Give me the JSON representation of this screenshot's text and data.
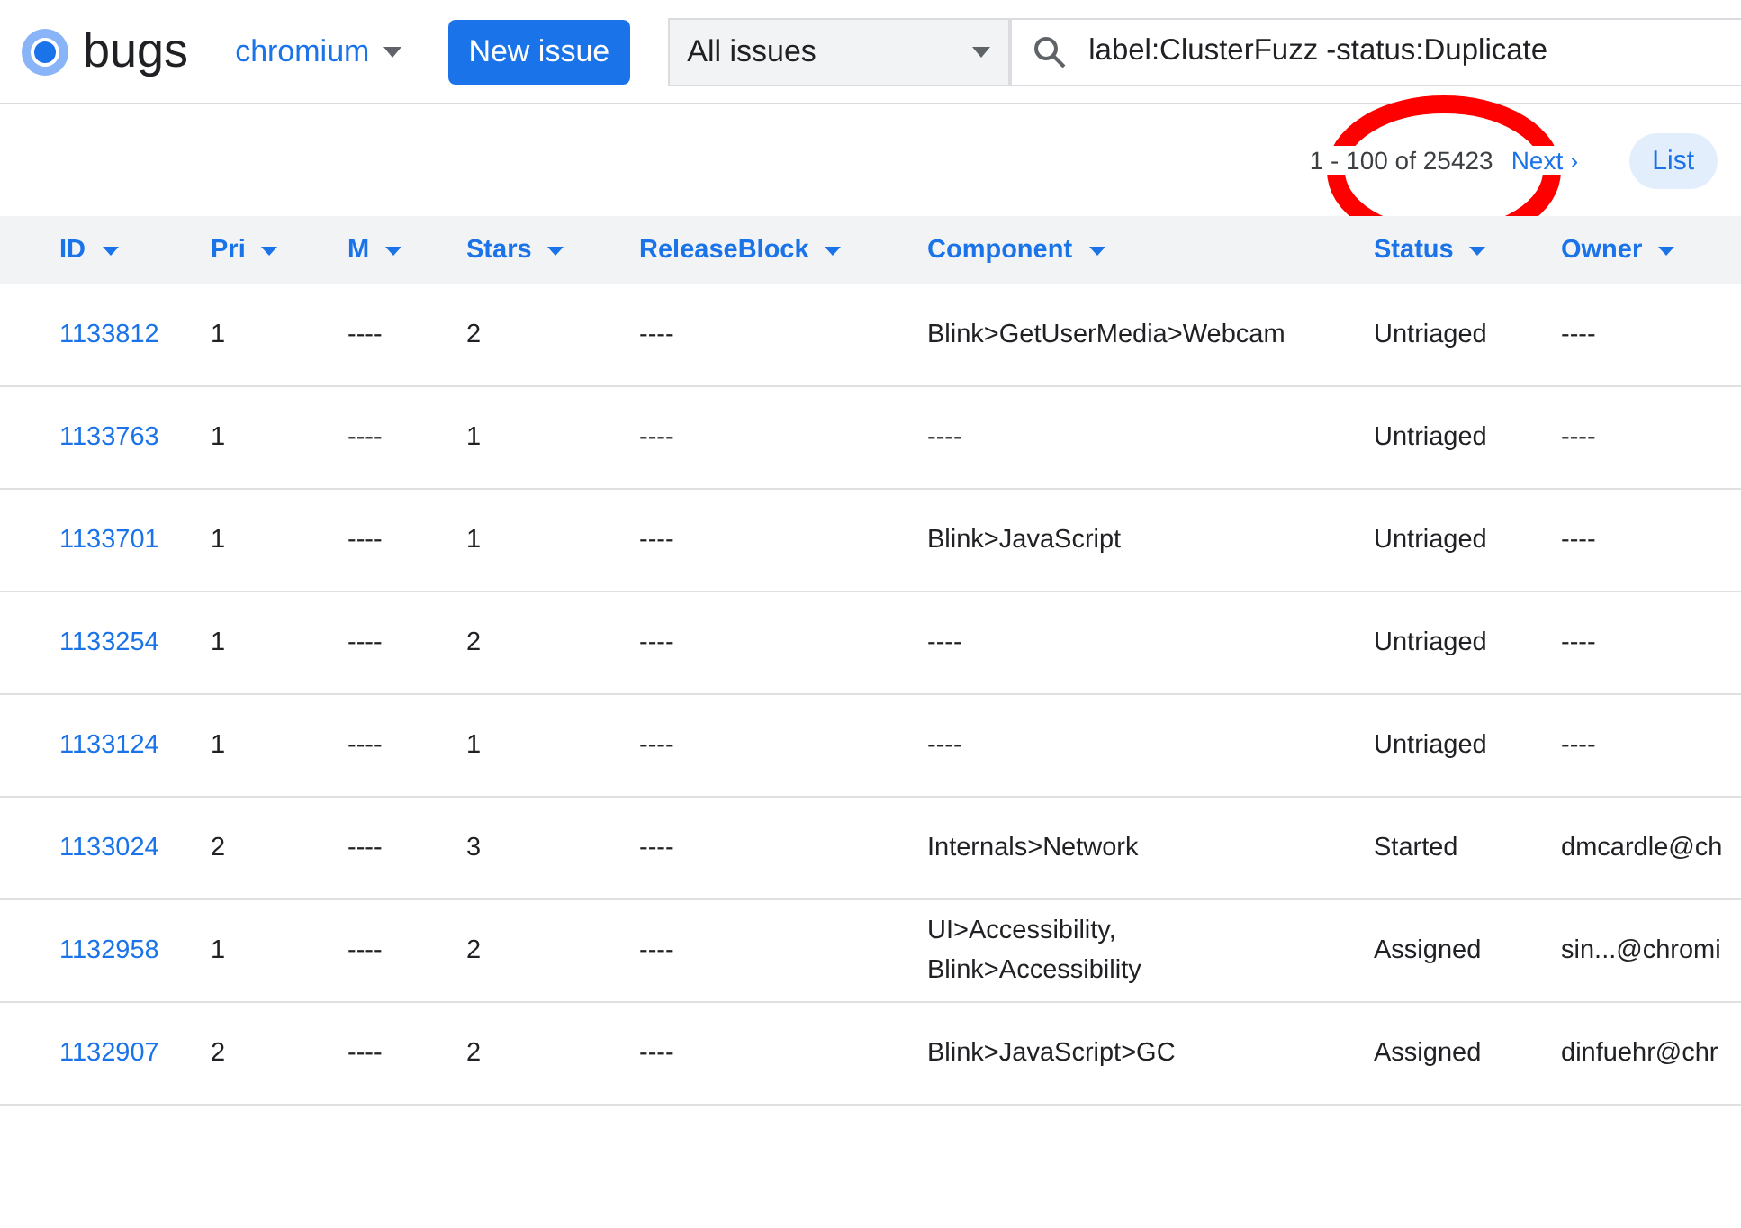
{
  "header": {
    "app_name": "bugs",
    "project": "chromium",
    "new_issue_button": "New issue",
    "scope_select": "All issues",
    "search_value": "label:ClusterFuzz -status:Duplicate"
  },
  "pagination": {
    "range": "1 - 100 of 25423",
    "next": "Next ›",
    "view_button": "List"
  },
  "table": {
    "columns": [
      "ID",
      "Pri",
      "M",
      "Stars",
      "ReleaseBlock",
      "Component",
      "Status",
      "Owner"
    ],
    "rows": [
      {
        "id": "1133812",
        "pri": "1",
        "m": "----",
        "stars": "2",
        "release_block": "----",
        "component": "Blink>GetUserMedia>Webcam",
        "status": "Untriaged",
        "owner": "----"
      },
      {
        "id": "1133763",
        "pri": "1",
        "m": "----",
        "stars": "1",
        "release_block": "----",
        "component": "----",
        "status": "Untriaged",
        "owner": "----"
      },
      {
        "id": "1133701",
        "pri": "1",
        "m": "----",
        "stars": "1",
        "release_block": "----",
        "component": "Blink>JavaScript",
        "status": "Untriaged",
        "owner": "----"
      },
      {
        "id": "1133254",
        "pri": "1",
        "m": "----",
        "stars": "2",
        "release_block": "----",
        "component": "----",
        "status": "Untriaged",
        "owner": "----"
      },
      {
        "id": "1133124",
        "pri": "1",
        "m": "----",
        "stars": "1",
        "release_block": "----",
        "component": "----",
        "status": "Untriaged",
        "owner": "----"
      },
      {
        "id": "1133024",
        "pri": "2",
        "m": "----",
        "stars": "3",
        "release_block": "----",
        "component": "Internals>Network",
        "status": "Started",
        "owner": "dmcardle@ch"
      },
      {
        "id": "1132958",
        "pri": "1",
        "m": "----",
        "stars": "2",
        "release_block": "----",
        "component": "UI>Accessibility, Blink>Accessibility",
        "status": "Assigned",
        "owner": "sin...@chromi"
      },
      {
        "id": "1132907",
        "pri": "2",
        "m": "----",
        "stars": "2",
        "release_block": "----",
        "component": "Blink>JavaScript>GC",
        "status": "Assigned",
        "owner": "dinfuehr@chr"
      }
    ]
  }
}
